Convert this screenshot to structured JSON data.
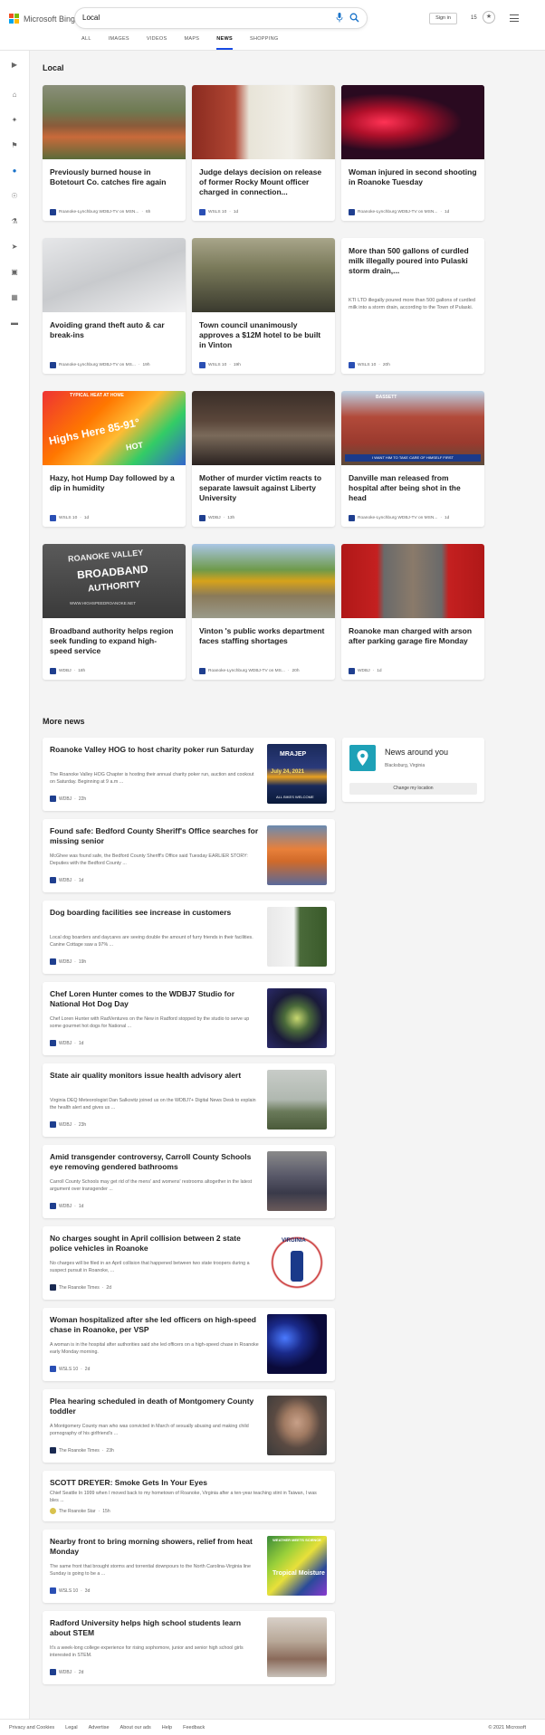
{
  "header": {
    "brand": "Microsoft Bing",
    "search_query": "Local",
    "tabs": [
      "ALL",
      "IMAGES",
      "VIDEOS",
      "MAPS",
      "NEWS",
      "SHOPPING"
    ],
    "active_tab": "NEWS",
    "sign_in": "Sign in",
    "rewards_count": "15"
  },
  "sidebar": {
    "icons": [
      "expand-icon",
      "home-icon",
      "sports-icon",
      "flag-icon",
      "location-pin-icon",
      "globe-icon",
      "science-icon",
      "rocket-icon",
      "entertainment-icon",
      "money-icon",
      "car-icon"
    ]
  },
  "local": {
    "title": "Local",
    "cards": [
      {
        "title": "Previously burned house in Botetourt Co. catches fire again",
        "source": "Roanoke-Lynchburg WDBJ-TV on MSN...",
        "time": "6h"
      },
      {
        "title": "Judge delays decision on release of former Rocky Mount officer charged in connection...",
        "source": "WSLS 10",
        "time": "1d"
      },
      {
        "title": "Woman injured in second shooting in Roanoke Tuesday",
        "source": "Roanoke-Lynchburg WDBJ-TV on MSN...",
        "time": "1d"
      },
      {
        "title": "Avoiding grand theft auto & car break-ins",
        "source": "Roanoke-Lynchburg WDBJ-TV on MS...",
        "time": "19h"
      },
      {
        "title": "Town council unanimously approves a $12M hotel to be built in Vinton",
        "source": "WSLS 10",
        "time": "19h"
      },
      {
        "title": "More than 500 gallons of curdled milk illegally poured into Pulaski storm drain,...",
        "snippet": "KTI LTD illegally poured more than 500 gallons of curdled milk into a storm drain, according to the Town of Pulaski.",
        "source": "WSLS 10",
        "time": "20h"
      },
      {
        "title": "Hazy, hot Hump Day followed by a dip in humidity",
        "source": "WSLS 10",
        "time": "1d"
      },
      {
        "title": "Mother of murder victim reacts to separate lawsuit against Liberty University",
        "source": "WDBJ",
        "time": "13h"
      },
      {
        "title": "Danville man released from hospital after being shot in the head",
        "source": "Roanoke-Lynchburg WDBJ-TV on MSN...",
        "time": "1d"
      },
      {
        "title": "Broadband authority helps region seek funding to expand high-speed service",
        "source": "WDBJ",
        "time": "18h"
      },
      {
        "title": "Vinton 's public works department faces staffing shortages",
        "source": "Roanoke-Lynchburg WDBJ-TV on MS...",
        "time": "20h"
      },
      {
        "title": "Roanoke man charged with arson after parking garage fire Monday",
        "source": "WDBJ",
        "time": "1d"
      }
    ]
  },
  "more_news": {
    "title": "More news",
    "items": [
      {
        "title": "Roanoke Valley HOG to host charity poker run Saturday",
        "snippet": "The Roanoke Valley HOG Chapter is hosting their annual charity poker run, auction and cookout on Saturday. Beginning at 9 a.m ...",
        "source": "WDBJ",
        "time": "22h"
      },
      {
        "title": "Found safe: Bedford County Sheriff's Office searches for missing senior",
        "snippet": "McGhee was found safe, the Bedford County Sheriff's Office said Tuesday EARLIER STORY: Deputies with the Bedford County ...",
        "source": "WDBJ",
        "time": "1d"
      },
      {
        "title": "Dog boarding facilities see increase in customers",
        "snippet": "Local dog boarders and daycares are seeing double the amount of furry friends in their facilities. Canine Cottage saw a 97% ...",
        "source": "WDBJ",
        "time": "19h"
      },
      {
        "title": "Chef Loren Hunter comes to the WDBJ7 Studio for National Hot Dog Day",
        "snippet": "Chef Loren Hunter with RadVentures on the New in Radford stopped by the studio to serve up some gourmet hot dogs for National ...",
        "source": "WDBJ",
        "time": "1d"
      },
      {
        "title": "State air quality monitors issue health advisory alert",
        "snippet": "Virginia DEQ Meteorologist Dan Salkovitz joined us on the WDBJ7+ Digital News Desk to explain the health alert and gives us ...",
        "source": "WDBJ",
        "time": "23h"
      },
      {
        "title": "Amid transgender controversy, Carroll County Schools eye removing gendered bathrooms",
        "snippet": "Carroll County Schools may get rid of the mens' and womens' restrooms altogether in the latest argument over transgender ...",
        "source": "WDBJ",
        "time": "1d"
      },
      {
        "title": "No charges sought in April collision between 2 state police vehicles in Roanoke",
        "snippet": "No charges will be filed in an April collision that happened between two state troopers during a suspect pursuit in Roanoke, ...",
        "source": "The Roanoke Times",
        "time": "2d"
      },
      {
        "title": "Woman hospitalized after she led officers on high-speed chase in Roanoke, per VSP",
        "snippet": "A woman is in the hospital after authorities said she led officers on a high-speed chase in Roanoke early Monday morning.",
        "source": "WSLS 10",
        "time": "2d"
      },
      {
        "title": "Plea hearing scheduled in death of Montgomery County toddler",
        "snippet": "A Montgomery County man who was convicted in March of sexually abusing and making child pornography of his girlfriend's ...",
        "source": "The Roanoke Times",
        "time": "23h"
      },
      {
        "title": "SCOTT DREYER: Smoke Gets In Your Eyes",
        "snippet": "Chief Seattle In 1999 when I moved back to my hometown of Roanoke, Virginia after a ten-year teaching stint in Taiwan, I was bles ...",
        "source": "The Roanoke Star",
        "time": "15h"
      },
      {
        "title": "Nearby front to bring morning showers, relief from heat Monday",
        "snippet": "The same front that brought storms and torrential downpours to the North Carolina-Virginia line Sunday is going to be a ...",
        "source": "WSLS 10",
        "time": "3d"
      },
      {
        "title": "Radford University helps high school students learn about STEM",
        "snippet": "It's a week-long college experience for rising sophomore, junior and senior high school girls interested in STEM.",
        "source": "WDBJ",
        "time": "2d"
      }
    ]
  },
  "news_around": {
    "title": "News around you",
    "location": "Blacksburg, Virginia",
    "button": "Change my location"
  },
  "image_texts": {
    "weather_banner": "TYPICAL HEAT AT HOME",
    "weather_big": "Highs Here 85-91°",
    "weather_hot": "HOT",
    "danville_banner": "BASSETT",
    "danville_caption": "I WANT HIM TO TAKE CARE OF HIMSELF FIRST",
    "broadband_1": "ROANOKE VALLEY",
    "broadband_2": "BROADBAND",
    "broadband_3": "AUTHORITY",
    "broadband_url": "WWW.HIGHSPEEDROANOKE.NET",
    "poker_top": "MRAJEP",
    "poker_date": "July 24, 2021",
    "poker_bottom": "ALL BIKES WELCOME",
    "seal": "VIRGINIA",
    "weather_top": "WEATHER MEETS SCIENCE",
    "weather_bottom": "Tropical Moisture"
  },
  "footer": {
    "links": [
      "Privacy and Cookies",
      "Legal",
      "Advertise",
      "About our ads",
      "Help",
      "Feedback"
    ],
    "copyright": "© 2021 Microsoft"
  },
  "colors": {
    "accent": "#174ae4",
    "pin": "#1ea1b7",
    "wdbj": "#1f3f8f",
    "wsls": "#2a4fb4",
    "roanoke_times": "#1a2a52",
    "roanoke_star": "#d9c24e"
  }
}
